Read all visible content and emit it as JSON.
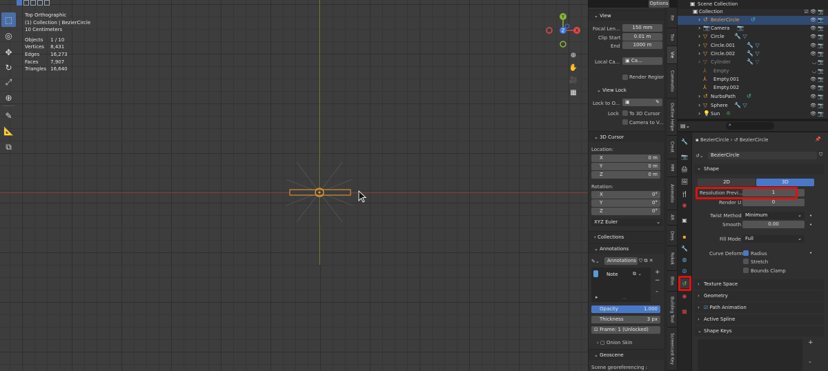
{
  "viewport": {
    "options_label": "Options",
    "view_name": "Top Orthographic",
    "collection_line": "(1) Collection | BezierCircle",
    "scale": "10 Centimeters",
    "stats": [
      {
        "label": "Objects",
        "value": "1 / 10"
      },
      {
        "label": "Vertices",
        "value": "8,431"
      },
      {
        "label": "Edges",
        "value": "16,273"
      },
      {
        "label": "Faces",
        "value": "7,907"
      },
      {
        "label": "Triangles",
        "value": "16,640"
      }
    ],
    "gizmo": {
      "y": "Y",
      "x": "X",
      "z": "Z"
    }
  },
  "npanel": {
    "view_header": "View",
    "focal_label": "Focal Len...",
    "focal_value": "150 mm",
    "clip_start_label": "Clip Start",
    "clip_start_value": "0.01 m",
    "end_label": "End",
    "end_value": "1000 m",
    "local_cam_label": "Local Ca...",
    "local_cam_value": "Ca...",
    "render_region": "Render Region",
    "view_lock_header": "View Lock",
    "lock_to_label": "Lock to O...",
    "lock_label": "Lock",
    "to_3d_cursor": "To 3D Cursor",
    "camera_to_view": "Camera to V...",
    "cursor_header": "3D Cursor",
    "location_label": "Location:",
    "loc": [
      {
        "axis": "X",
        "value": "0 m"
      },
      {
        "axis": "Y",
        "value": "0 m"
      },
      {
        "axis": "Z",
        "value": "0 m"
      }
    ],
    "rotation_label": "Rotation:",
    "rot": [
      {
        "axis": "X",
        "value": "0°"
      },
      {
        "axis": "Y",
        "value": "0°"
      },
      {
        "axis": "Z",
        "value": "0°"
      }
    ],
    "rot_mode": "XYZ Euler",
    "collections_header": "Collections",
    "annotations_header": "Annotations",
    "annotations_name": "Annotations",
    "note_label": "Note",
    "opacity_label": "Opacity",
    "opacity_value": "1.000",
    "opacity": 1.0,
    "thickness_label": "Thickness",
    "thickness_value": "3 px",
    "frame_label": "Frame: 1 (Unlocked)",
    "onion_label": "Onion Skin",
    "geoscene_header": "Geoscene",
    "geoscene_text": "Scene georeferencing :"
  },
  "side_tabs": [
    "Ite",
    "Too",
    "Vie",
    "Commotio",
    "Outline Helpe",
    "Creat",
    "MM",
    "Animatio",
    "AR",
    "Dres",
    "Rokok",
    "Blos",
    "Building Tool",
    "Screencast Key"
  ],
  "outliner": {
    "title": "Scene Collection",
    "collection": "Collection",
    "items": [
      {
        "name": "BezierCircle",
        "icon_color": "#f0a030"
      },
      {
        "name": "Camera",
        "icon_color": "#f0a030"
      },
      {
        "name": "Circle",
        "icon_color": "#f0a030"
      },
      {
        "name": "Circle.001",
        "icon_color": "#f0a030"
      },
      {
        "name": "Circle.002",
        "icon_color": "#f0a030"
      },
      {
        "name": "Cylinder",
        "icon_color": "#f0a030"
      },
      {
        "name": "Empty",
        "icon_color": "#f0a030"
      },
      {
        "name": "Empty.001",
        "icon_color": "#f0a030"
      },
      {
        "name": "Empty.002",
        "icon_color": "#f0a030"
      },
      {
        "name": "NurbsPath",
        "icon_color": "#f0a030"
      },
      {
        "name": "Sphere",
        "icon_color": "#f0a030"
      },
      {
        "name": "Sun",
        "icon_color": "#f0a030"
      }
    ]
  },
  "properties": {
    "breadcrumb_obj": "BezierCircle",
    "breadcrumb_data": "BezierCircle",
    "datablock": "BezierCircle",
    "shape_header": "Shape",
    "mode_2d": "2D",
    "mode_3d": "3D",
    "res_preview_label": "Resolution Previ...",
    "res_preview_value": "1",
    "render_u_label": "Render U",
    "render_u_value": "0",
    "twist_method_label": "Twist Method",
    "twist_method_value": "Minimum",
    "smooth_label": "Smooth",
    "smooth_value": "0.00",
    "fill_mode_label": "Fill Mode",
    "fill_mode_value": "Full",
    "curve_deform_label": "Curve Deform",
    "radius_label": "Radius",
    "stretch_label": "Stretch",
    "bounds_clamp_label": "Bounds Clamp",
    "texture_space": "Texture Space",
    "geometry": "Geometry",
    "path_animation": "Path Animation",
    "active_spline": "Active Spline",
    "shape_keys": "Shape Keys"
  },
  "colors": {
    "accent": "#4a78c8",
    "highlight": "#e01010",
    "selection": "#f0a030"
  }
}
